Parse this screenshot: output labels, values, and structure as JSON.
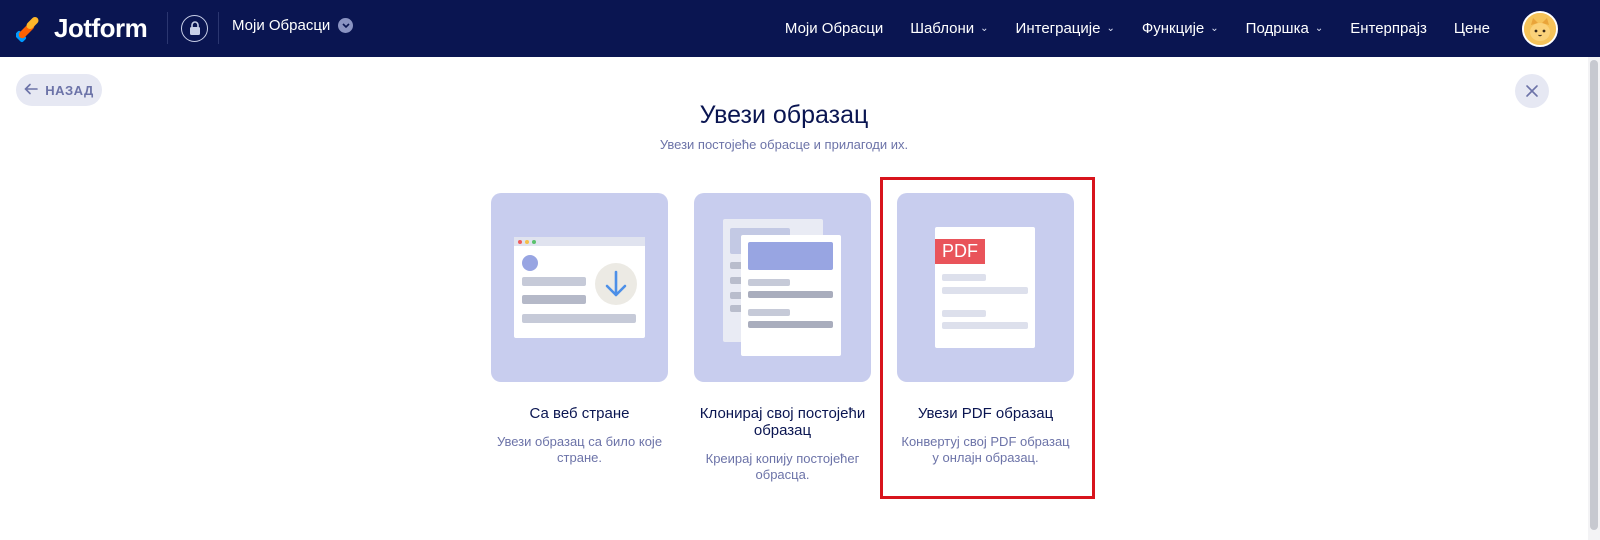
{
  "brand": {
    "name": "Jotform"
  },
  "header": {
    "forms_dropdown_label": "Моји Обрасци",
    "nav": [
      {
        "label": "Моји Обрасци",
        "has_dropdown": false
      },
      {
        "label": "Шаблони",
        "has_dropdown": true
      },
      {
        "label": "Интеграције",
        "has_dropdown": true
      },
      {
        "label": "Функције",
        "has_dropdown": true
      },
      {
        "label": "Подршка",
        "has_dropdown": true
      },
      {
        "label": "Ентерпрајз",
        "has_dropdown": false
      },
      {
        "label": "Цене",
        "has_dropdown": false
      }
    ]
  },
  "page": {
    "back_label": "НАЗАД",
    "title": "Увези образац",
    "subtitle": "Увези постојеће обрасце и прилагоди их."
  },
  "options": [
    {
      "title": "Са веб стране",
      "description": "Увези образац са било које стране."
    },
    {
      "title": "Клонирај свој постојећи образац",
      "description": "Креирај копију постојећег обрасца."
    },
    {
      "title": "Увези PDF образац",
      "description": "Конвертуј свој PDF образац у онлајн образац.",
      "highlighted": true,
      "badge": "PDF"
    }
  ],
  "colors": {
    "nav_bg": "#0a1551",
    "card_bg": "#c8cdee",
    "highlight": "#d8141c",
    "pdf_badge": "#e9545a",
    "download_arrow": "#4c8fe8"
  },
  "icons": [
    "jotform-logo-icon",
    "lock-icon",
    "chevron-down-icon",
    "arrow-left-icon",
    "close-icon",
    "download-arrow-icon",
    "avatar-cat-icon"
  ]
}
